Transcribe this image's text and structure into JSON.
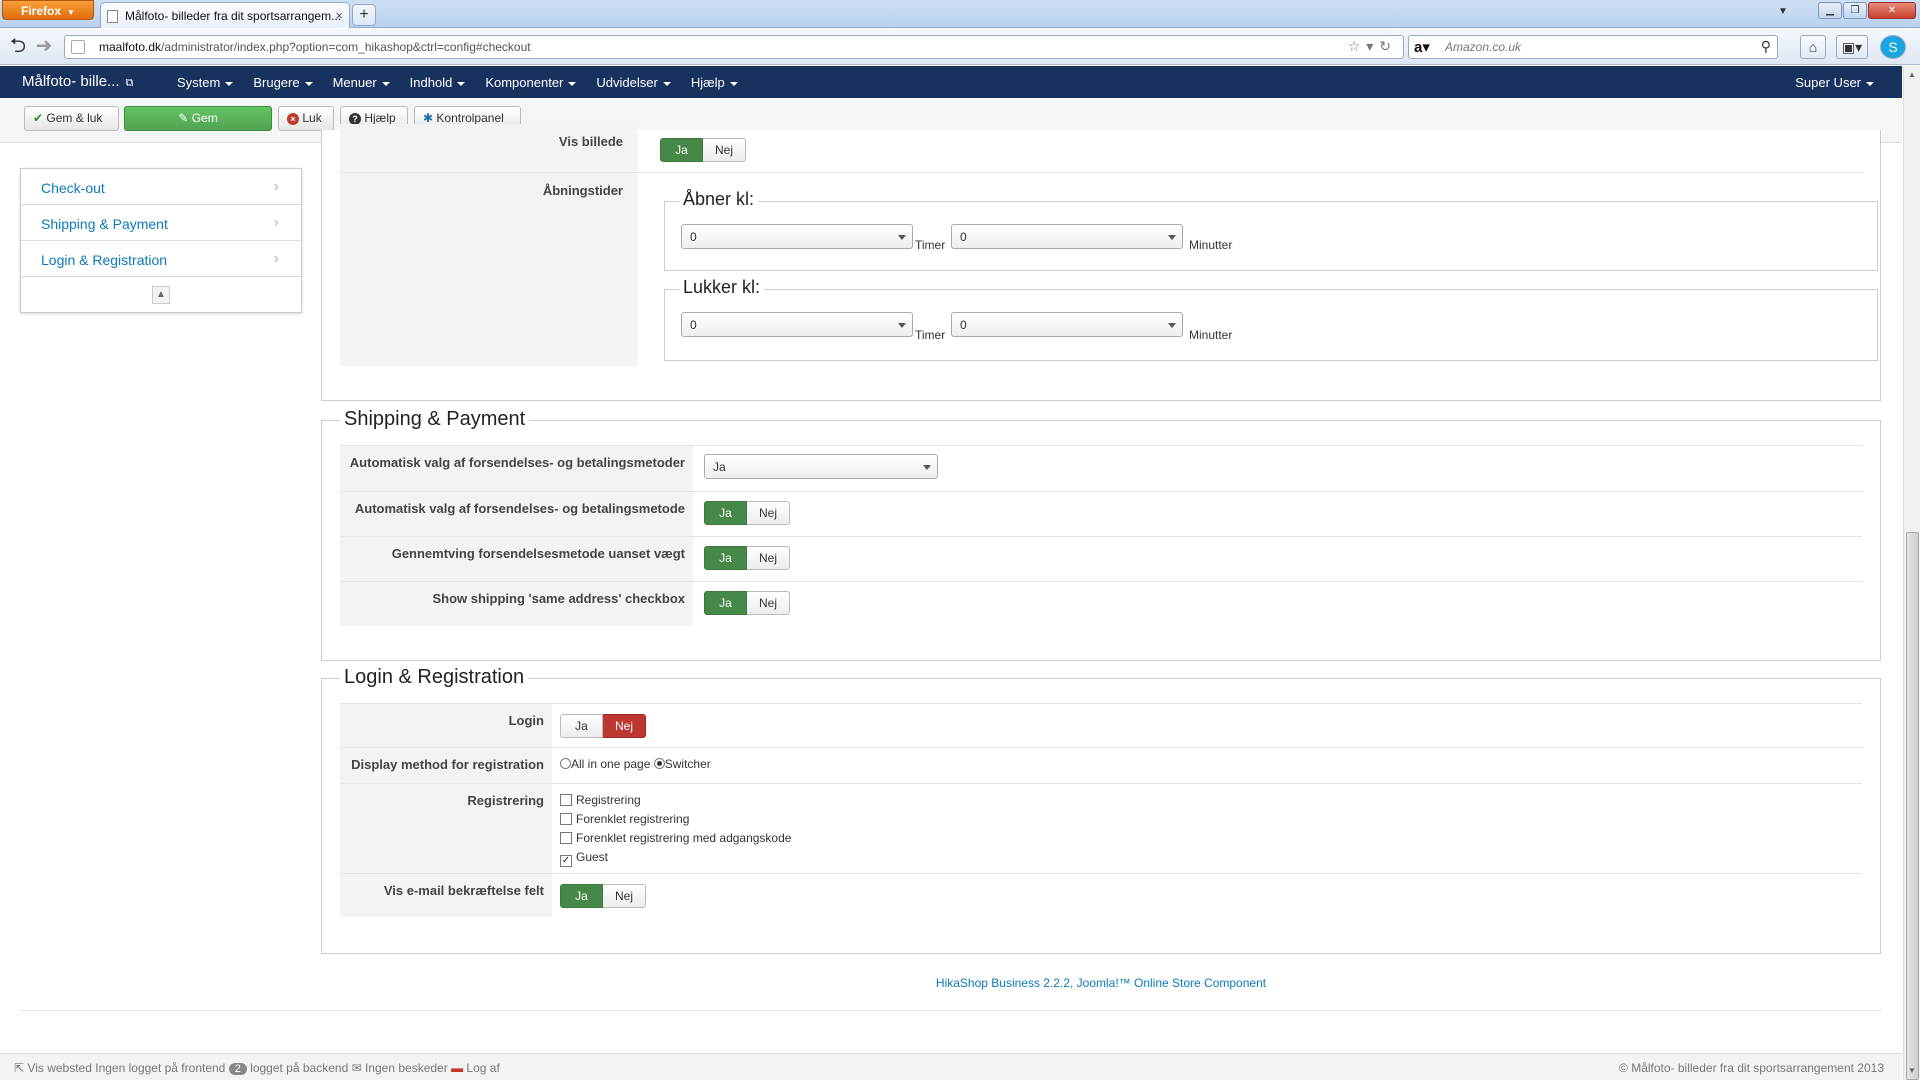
{
  "browser": {
    "menu_label": "Firefox",
    "tab_title": "Målfoto- billeder fra dit sportsarrangem...",
    "url_domain": "maalfoto.dk",
    "url_path": "/administrator/index.php?option=com_hikashop&ctrl=config#checkout",
    "search_placeholder": "Amazon.co.uk"
  },
  "admin_nav": {
    "brand": "Målfoto- bille...",
    "menu": [
      "System",
      "Brugere",
      "Menuer",
      "Indhold",
      "Komponenter",
      "Udvidelser",
      "Hjælp"
    ],
    "user": "Super User"
  },
  "toolbar": {
    "save_close": "Gem & luk",
    "save": "Gem",
    "close": "Luk",
    "help": "Hjælp",
    "control_panel": "Kontrolpanel"
  },
  "sidebar": {
    "items": [
      "Check-out",
      "Shipping & Payment",
      "Login & Registration"
    ]
  },
  "checkout": {
    "show_image_label": "Vis billede",
    "show_image": {
      "yes": "Ja",
      "no": "Nej",
      "selected": "Ja"
    },
    "opening_hours_label": "Åbningstider",
    "opens_legend": "Åbner kl:",
    "closes_legend": "Lukker kl:",
    "opens_hours": "0",
    "opens_minutes": "0",
    "closes_hours": "0",
    "closes_minutes": "0",
    "hours_unit": "Timer",
    "minutes_unit": "Minutter"
  },
  "shipping_payment": {
    "legend": "Shipping & Payment",
    "rows": [
      {
        "label": "Automatisk valg af forsendelses- og betalingsmetoder",
        "type": "select",
        "value": "Ja"
      },
      {
        "label": "Automatisk valg af forsendelses- og betalingsmetode",
        "type": "toggle",
        "yes": "Ja",
        "no": "Nej",
        "selected": "Ja"
      },
      {
        "label": "Gennemtving forsendelsesmetode uanset vægt",
        "type": "toggle",
        "yes": "Ja",
        "no": "Nej",
        "selected": "Ja"
      },
      {
        "label": "Show shipping 'same address' checkbox",
        "type": "toggle",
        "yes": "Ja",
        "no": "Nej",
        "selected": "Ja"
      }
    ]
  },
  "login_registration": {
    "legend": "Login & Registration",
    "login_label": "Login",
    "login": {
      "yes": "Ja",
      "no": "Nej",
      "selected": "Nej"
    },
    "display_method_label": "Display method for registration",
    "display_method_options": [
      "All in one page",
      "Switcher"
    ],
    "display_method_selected": "Switcher",
    "registration_label": "Registrering",
    "registration_options": [
      {
        "label": "Registrering",
        "checked": false
      },
      {
        "label": "Forenklet registrering",
        "checked": false
      },
      {
        "label": "Forenklet registrering med adgangskode",
        "checked": false
      },
      {
        "label": "Guest",
        "checked": true
      }
    ],
    "email_confirm_label": "Vis e-mail bekræftelse felt",
    "email_confirm": {
      "yes": "Ja",
      "no": "Nej",
      "selected": "Ja"
    }
  },
  "footer": {
    "credit": "HikaShop Business 2.2.2, Joomla!™ Online Store Component"
  },
  "statusbar": {
    "view_site": "Vis websted",
    "frontend": "Ingen logget på frontend",
    "backend_count": "2",
    "backend": "logget på backend",
    "messages": "Ingen beskeder",
    "logout": "Log af",
    "copyright": "© Målfoto- billeder fra dit sportsarrangement 2013"
  },
  "colors": {
    "nav_bg": "#17325f",
    "toggle_yes": "#468847",
    "toggle_no": "#bd362f",
    "primary_button": "#51a351",
    "link": "#0c7ab8"
  }
}
